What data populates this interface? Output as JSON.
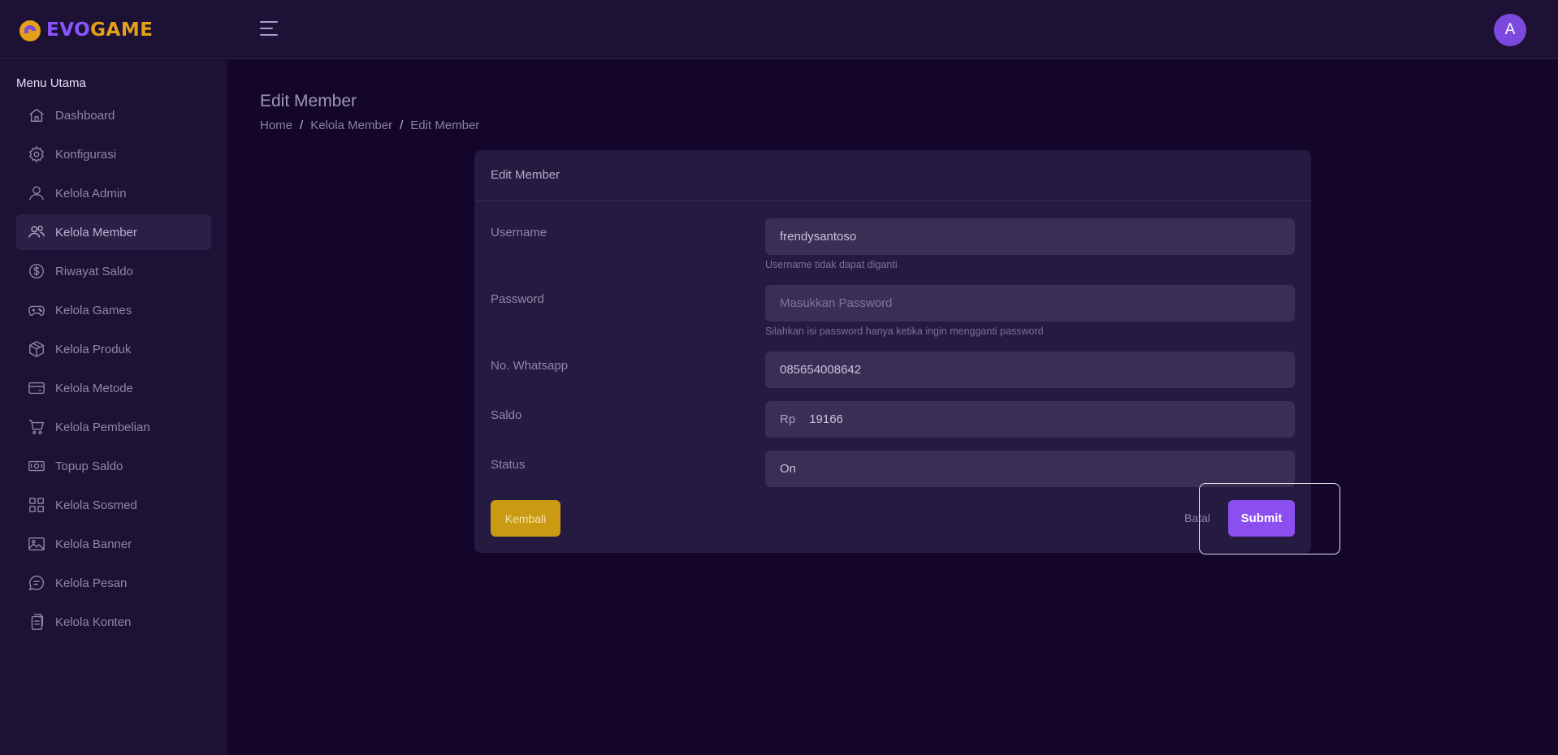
{
  "brand": {
    "part1": "EVO",
    "part2": "GAME"
  },
  "user": {
    "avatar_initial": "A"
  },
  "sidebar": {
    "title": "Menu Utama",
    "items": [
      {
        "label": "Dashboard",
        "icon": "home-icon"
      },
      {
        "label": "Konfigurasi",
        "icon": "gear-icon"
      },
      {
        "label": "Kelola Admin",
        "icon": "user-icon"
      },
      {
        "label": "Kelola Member",
        "icon": "users-icon",
        "active": true
      },
      {
        "label": "Riwayat Saldo",
        "icon": "dollar-circle-icon"
      },
      {
        "label": "Kelola Games",
        "icon": "gamepad-icon"
      },
      {
        "label": "Kelola Produk",
        "icon": "box-icon"
      },
      {
        "label": "Kelola Metode",
        "icon": "credit-card-icon"
      },
      {
        "label": "Kelola Pembelian",
        "icon": "cart-icon"
      },
      {
        "label": "Topup Saldo",
        "icon": "cash-icon"
      },
      {
        "label": "Kelola Sosmed",
        "icon": "grid-icon"
      },
      {
        "label": "Kelola Banner",
        "icon": "image-icon"
      },
      {
        "label": "Kelola Pesan",
        "icon": "message-icon"
      },
      {
        "label": "Kelola Konten",
        "icon": "documents-icon"
      }
    ]
  },
  "page": {
    "title": "Edit Member",
    "breadcrumb": [
      "Home",
      "Kelola Member",
      "Edit Member"
    ]
  },
  "form": {
    "card_title": "Edit Member",
    "username": {
      "label": "Username",
      "value": "frendysantoso",
      "hint": "Username tidak dapat diganti"
    },
    "password": {
      "label": "Password",
      "placeholder": "Masukkan Password",
      "hint": "Silahkan isi password hanya ketika ingin mengganti password"
    },
    "whatsapp": {
      "label": "No. Whatsapp",
      "value": "085654008642"
    },
    "saldo": {
      "label": "Saldo",
      "prefix": "Rp",
      "value": "19166"
    },
    "status": {
      "label": "Status",
      "value": "On"
    },
    "back_label": "Kembali",
    "cancel_label": "Batal",
    "submit_label": "Submit"
  },
  "colors": {
    "background": "#14062b",
    "panel": "#1d1235",
    "card": "#251a3f",
    "accent": "#8b4ef0",
    "warning": "#c99a12",
    "brand_orange": "#e3a018"
  }
}
